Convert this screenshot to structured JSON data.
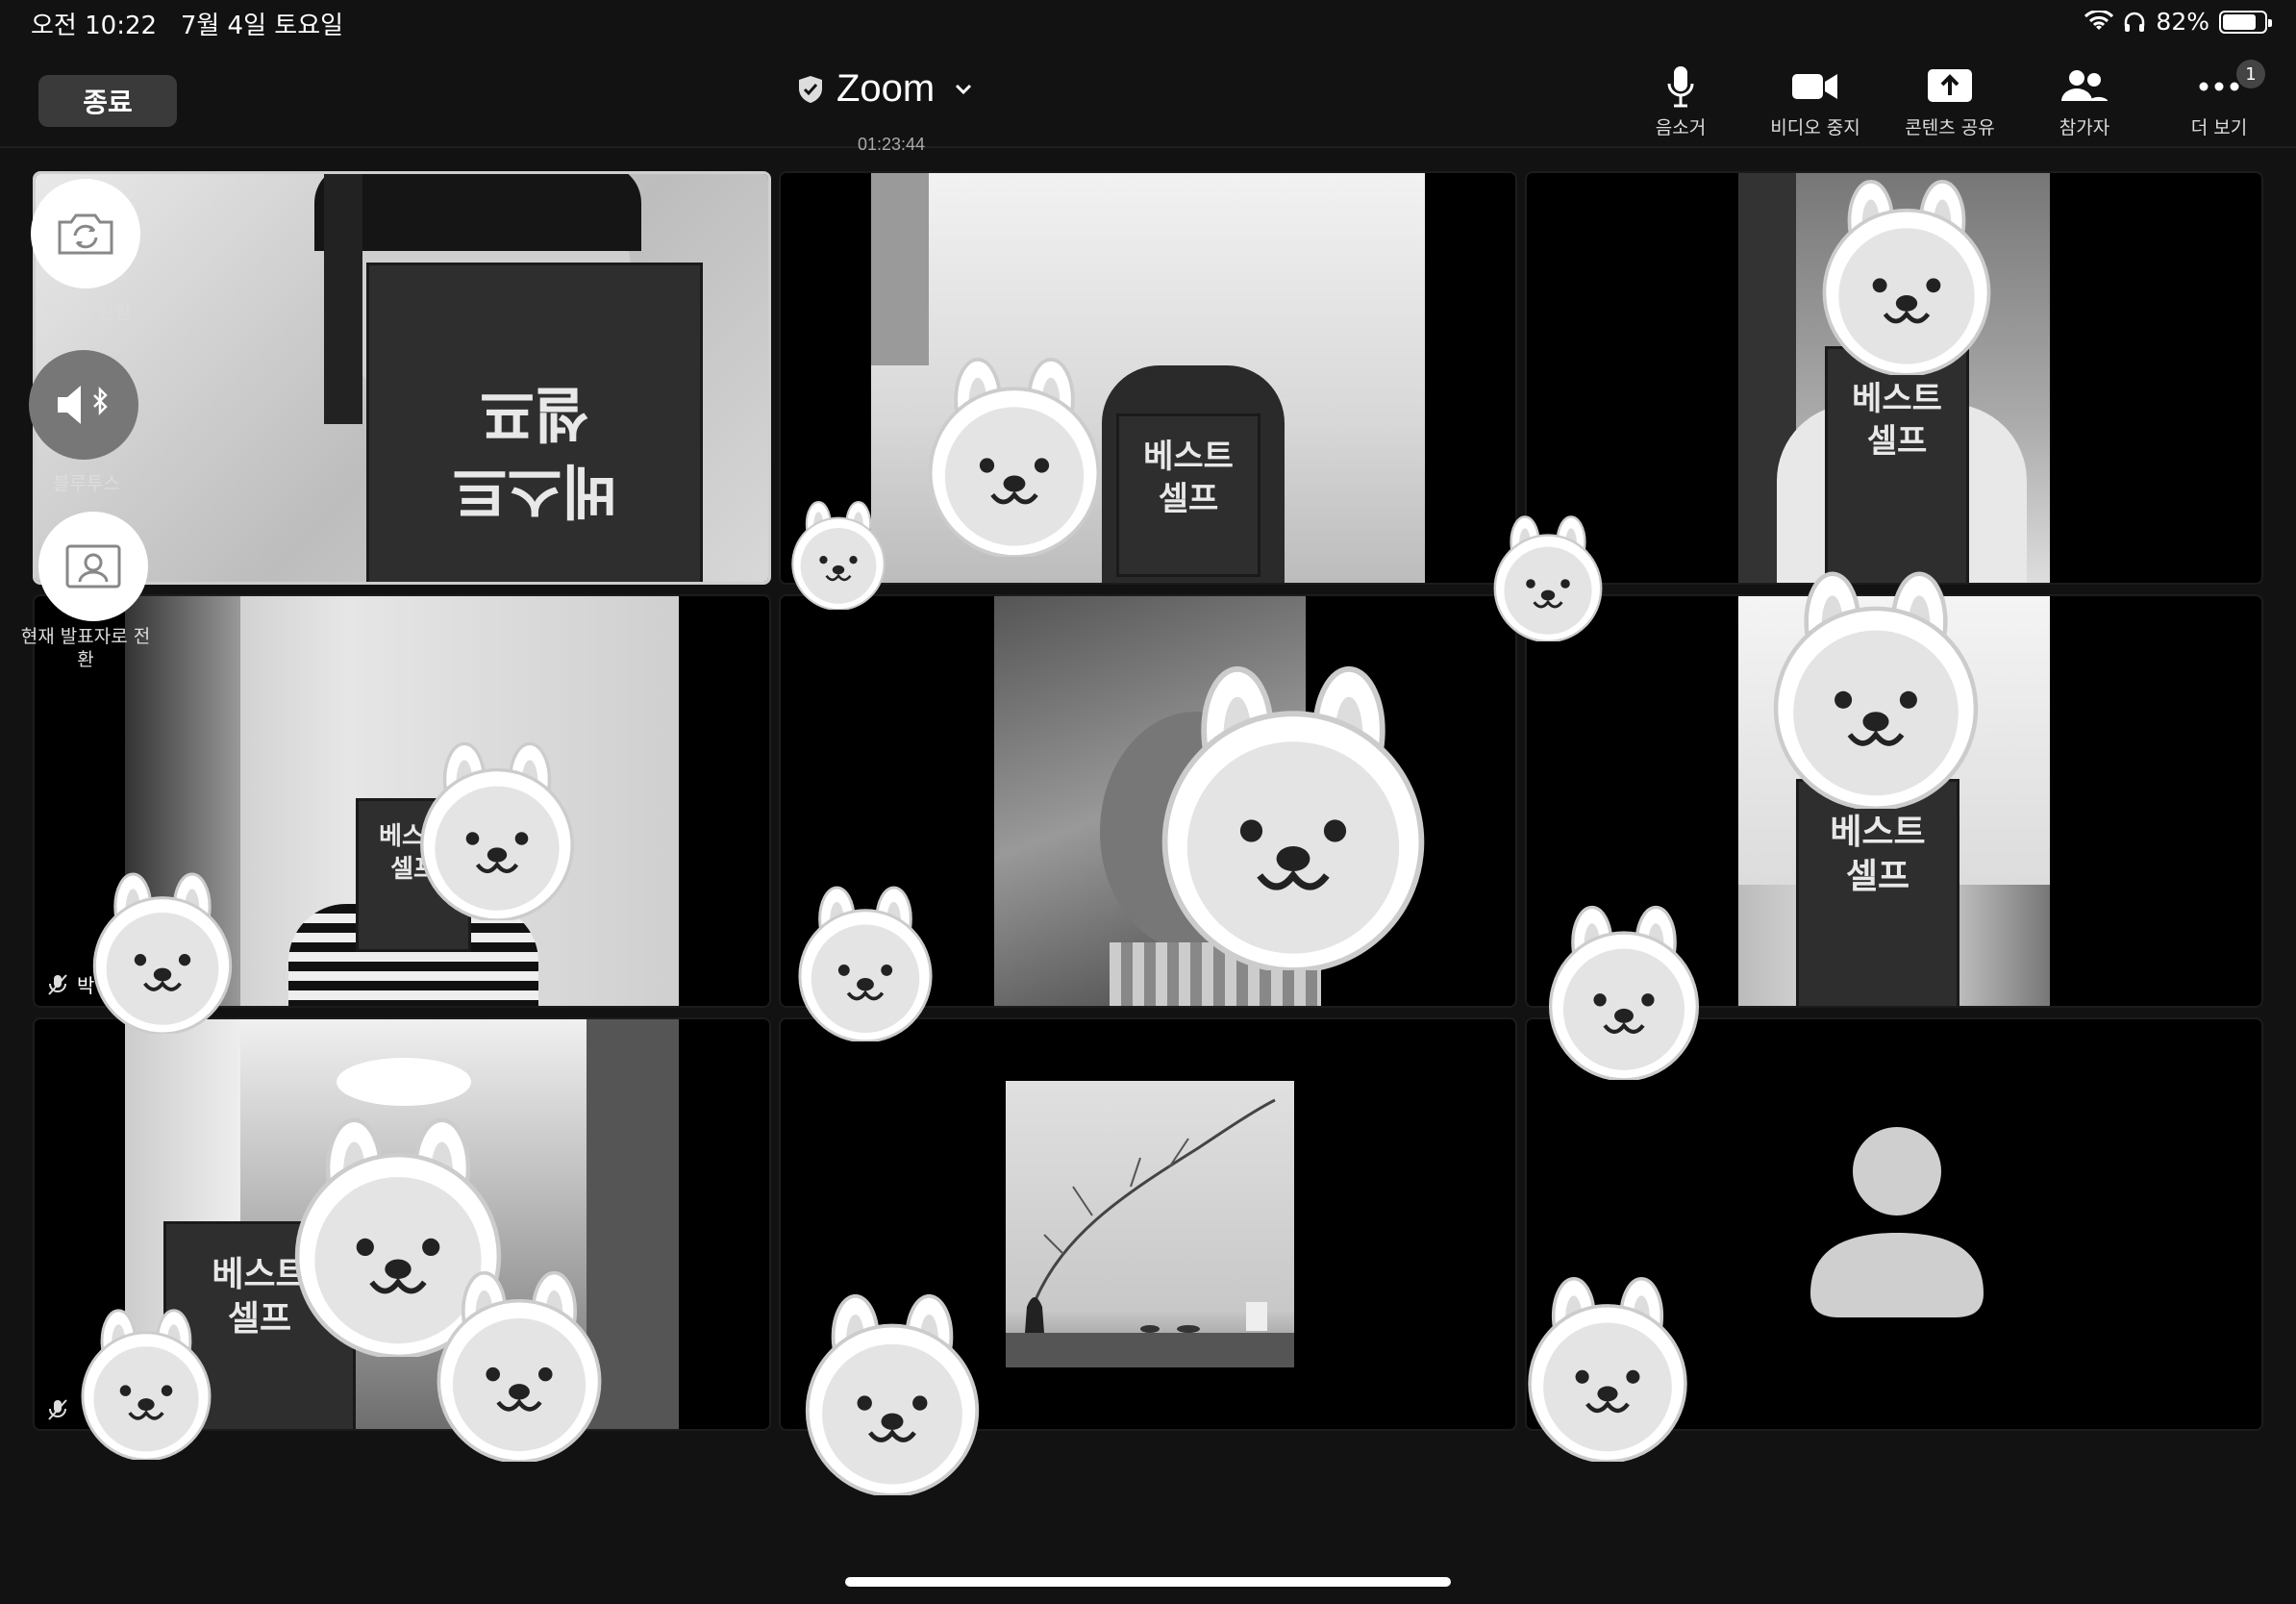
{
  "status_bar": {
    "time": "오전 10:22   7월 4일 토요일",
    "battery": "82%",
    "battery_level": 0.82
  },
  "toolbar": {
    "end_label": "종료",
    "title": "Zoom",
    "elapsed": "01:23:44",
    "mute_label": "음소거",
    "video_label": "비디오 중지",
    "share_label": "콘텐츠 공유",
    "participants_label": "참가자",
    "more_label": "더 보기",
    "more_badge": "1"
  },
  "side_controls": {
    "camera_switch": "카메라 전환",
    "bluetooth": "블루투스",
    "switch_to_speaker": "현재 발표자로 전환"
  },
  "participants": {
    "tile4_name": "박"
  },
  "colors": {
    "background": "#121212",
    "tile": "#000000",
    "end_button": "#3a3a3a"
  }
}
